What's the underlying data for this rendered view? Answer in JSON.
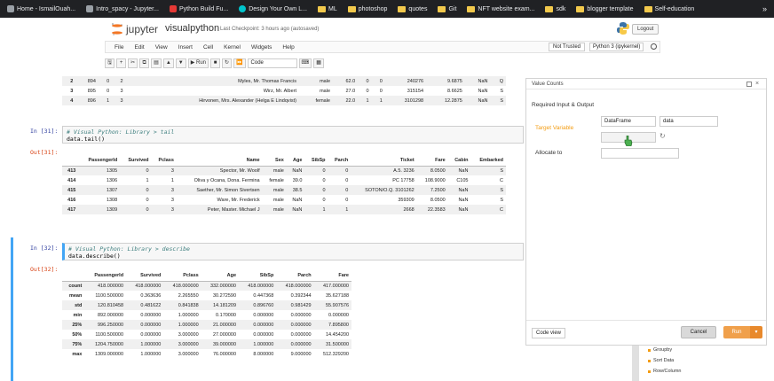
{
  "bookmarks": [
    {
      "label": "Home - IsmailOuah...",
      "icon": "page"
    },
    {
      "label": "Intro_spacy - Jupyter...",
      "icon": "page"
    },
    {
      "label": "Python Build Fu...",
      "icon": "yt"
    },
    {
      "label": "Design Your Own L...",
      "icon": "cv"
    },
    {
      "label": "ML",
      "icon": "folder"
    },
    {
      "label": "photoshop",
      "icon": "folder"
    },
    {
      "label": "quotes",
      "icon": "folder"
    },
    {
      "label": "Git",
      "icon": "folder"
    },
    {
      "label": "NFT website exam...",
      "icon": "folder"
    },
    {
      "label": "sdk",
      "icon": "folder"
    },
    {
      "label": "blogger template",
      "icon": "folder"
    },
    {
      "label": "Self-education",
      "icon": "folder"
    }
  ],
  "bookmarks_more": "»",
  "header": {
    "brand": "jupyter",
    "notebook_name": "visualpython",
    "checkpoint": "Last Checkpoint: 3 hours ago  (autosaved)",
    "logout": "Logout"
  },
  "menu": [
    "File",
    "Edit",
    "View",
    "Insert",
    "Cell",
    "Kernel",
    "Widgets",
    "Help"
  ],
  "trust": "Not Trusted",
  "kernel_name": "Python 3 (ipykernel)",
  "toolbar": {
    "buttons": [
      "🖫",
      "+",
      "✂",
      "⧉",
      "▤",
      "▲",
      "▼"
    ],
    "run": "▶ Run",
    "buttons2": [
      "■",
      "↻",
      "⏩"
    ],
    "cell_type": "Code",
    "buttons3": [
      "⌨",
      "▦"
    ]
  },
  "cells": {
    "top_table": {
      "rows": [
        [
          "2",
          "894",
          "0",
          "2",
          "Myles, Mr. Thomas Francis",
          "male",
          "62.0",
          "0",
          "0",
          "240276",
          "9.6875",
          "NaN",
          "Q"
        ],
        [
          "3",
          "895",
          "0",
          "3",
          "Wirz, Mr. Albert",
          "male",
          "27.0",
          "0",
          "0",
          "315154",
          "8.6625",
          "NaN",
          "S"
        ],
        [
          "4",
          "896",
          "1",
          "3",
          "Hirvonen, Mrs. Alexander (Helga E Lindqvist)",
          "female",
          "22.0",
          "1",
          "1",
          "3101298",
          "12.2875",
          "NaN",
          "S"
        ]
      ]
    },
    "in31": {
      "prompt": "In [31]:",
      "comment": "# Visual Python: Library > tail",
      "code": "data.tail()"
    },
    "out31": {
      "prompt": "Out[31]:",
      "columns": [
        "",
        "PassengerId",
        "Survived",
        "Pclass",
        "Name",
        "Sex",
        "Age",
        "SibSp",
        "Parch",
        "Ticket",
        "Fare",
        "Cabin",
        "Embarked"
      ],
      "rows": [
        [
          "413",
          "1305",
          "0",
          "3",
          "Spector, Mr. Woolf",
          "male",
          "NaN",
          "0",
          "0",
          "A.5. 3236",
          "8.0500",
          "NaN",
          "S"
        ],
        [
          "414",
          "1306",
          "1",
          "1",
          "Oliva y Ocana, Dona. Fermina",
          "female",
          "39.0",
          "0",
          "0",
          "PC 17758",
          "108.9000",
          "C105",
          "C"
        ],
        [
          "415",
          "1307",
          "0",
          "3",
          "Saether, Mr. Simon Sivertsen",
          "male",
          "38.5",
          "0",
          "0",
          "SOTON/O.Q. 3101262",
          "7.2500",
          "NaN",
          "S"
        ],
        [
          "416",
          "1308",
          "0",
          "3",
          "Ware, Mr. Frederick",
          "male",
          "NaN",
          "0",
          "0",
          "359309",
          "8.0500",
          "NaN",
          "S"
        ],
        [
          "417",
          "1309",
          "0",
          "3",
          "Peter, Master. Michael J",
          "male",
          "NaN",
          "1",
          "1",
          "2668",
          "22.3583",
          "NaN",
          "C"
        ]
      ]
    },
    "in32": {
      "prompt": "In [32]:",
      "comment": "# Visual Python: Library > describe",
      "code": "data.describe()"
    },
    "out32": {
      "prompt": "Out[32]:",
      "columns": [
        "",
        "PassengerId",
        "Survived",
        "Pclass",
        "Age",
        "SibSp",
        "Parch",
        "Fare"
      ],
      "rows": [
        [
          "count",
          "418.000000",
          "418.000000",
          "418.000000",
          "332.000000",
          "418.000000",
          "418.000000",
          "417.000000"
        ],
        [
          "mean",
          "1100.500000",
          "0.363636",
          "2.265550",
          "30.272590",
          "0.447368",
          "0.392344",
          "35.627188"
        ],
        [
          "std",
          "120.810458",
          "0.481622",
          "0.841838",
          "14.181209",
          "0.896760",
          "0.981429",
          "55.907576"
        ],
        [
          "min",
          "892.000000",
          "0.000000",
          "1.000000",
          "0.170000",
          "0.000000",
          "0.000000",
          "0.000000"
        ],
        [
          "25%",
          "996.250000",
          "0.000000",
          "1.000000",
          "21.000000",
          "0.000000",
          "0.000000",
          "7.895800"
        ],
        [
          "50%",
          "1100.500000",
          "0.000000",
          "3.000000",
          "27.000000",
          "0.000000",
          "0.000000",
          "14.454200"
        ],
        [
          "75%",
          "1204.750000",
          "1.000000",
          "3.000000",
          "39.000000",
          "1.000000",
          "0.000000",
          "31.500000"
        ],
        [
          "max",
          "1309.000000",
          "1.000000",
          "3.000000",
          "76.000000",
          "8.000000",
          "9.000000",
          "512.329200"
        ]
      ]
    }
  },
  "vp_panel": {
    "title": "Value Counts",
    "section": "Required Input & Output",
    "target_label": "Target Variable",
    "type_option": "DataFrame",
    "var_option": "data",
    "refresh": "↻",
    "allocate_label": "Allocate to",
    "code_view": "Code view",
    "cancel": "Cancel",
    "run": "Run",
    "run_more": "▾"
  },
  "library_list": [
    "Groupby",
    "Sort Data",
    "Row/Column"
  ],
  "colors": {
    "accent": "#f0a04b",
    "prompt_in": "#303f9f",
    "prompt_out": "#d84315",
    "selected_cell": "#42a5f5"
  }
}
